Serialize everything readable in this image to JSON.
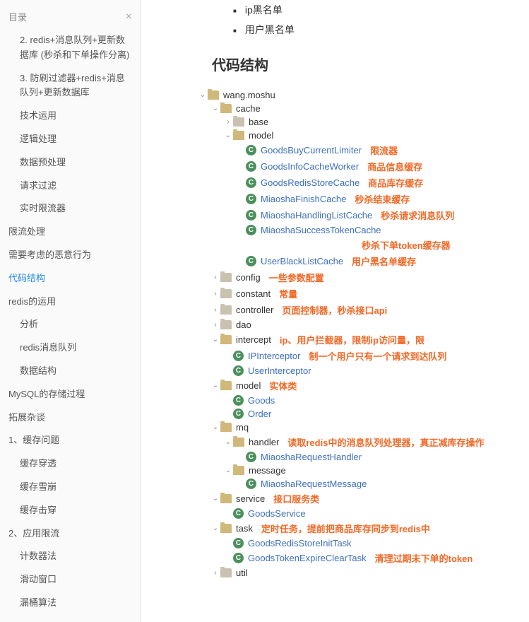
{
  "sidebar": {
    "title": "目录",
    "items": [
      {
        "label": "2. redis+消息队列+更新数据库 (秒杀和下单操作分离)",
        "level": 2
      },
      {
        "label": "3. 防刷过滤器+redis+消息队列+更新数据库",
        "level": 2
      },
      {
        "label": "技术运用",
        "level": 2
      },
      {
        "label": "逻辑处理",
        "level": 2
      },
      {
        "label": "数据预处理",
        "level": 2
      },
      {
        "label": "请求过滤",
        "level": 2
      },
      {
        "label": "实时限流器",
        "level": 2
      },
      {
        "label": "限流处理",
        "level": 1
      },
      {
        "label": "需要考虑的恶意行为",
        "level": 1
      },
      {
        "label": "代码结构",
        "level": 1,
        "active": true
      },
      {
        "label": "redis的运用",
        "level": 1
      },
      {
        "label": "分析",
        "level": 2
      },
      {
        "label": "redis消息队列",
        "level": 2
      },
      {
        "label": "数据结构",
        "level": 2
      },
      {
        "label": "MySQL的存储过程",
        "level": 1
      },
      {
        "label": "拓展杂谈",
        "level": 1
      },
      {
        "label": "1、缓存问题",
        "level": 1
      },
      {
        "label": "缓存穿透",
        "level": 2
      },
      {
        "label": "缓存雪崩",
        "level": 2
      },
      {
        "label": "缓存击穿",
        "level": 2
      },
      {
        "label": "2、应用限流",
        "level": 1
      },
      {
        "label": "计数器法",
        "level": 2
      },
      {
        "label": "滑动窗口",
        "level": 2
      },
      {
        "label": "漏桶算法",
        "level": 2
      }
    ]
  },
  "main": {
    "bullets": [
      "ip黑名单",
      "用户黑名单"
    ],
    "heading": "代码结构",
    "tree": [
      {
        "depth": 0,
        "arrow": "down",
        "icon": "folder",
        "label": "wang.moshu"
      },
      {
        "depth": 1,
        "arrow": "down",
        "icon": "folder",
        "label": "cache"
      },
      {
        "depth": 2,
        "arrow": "right",
        "icon": "folder-closed",
        "label": "base"
      },
      {
        "depth": 2,
        "arrow": "down",
        "icon": "folder",
        "label": "model"
      },
      {
        "depth": 3,
        "arrow": "",
        "icon": "class",
        "label": "GoodsBuyCurrentLimiter",
        "link": true,
        "ann": "限流器"
      },
      {
        "depth": 3,
        "arrow": "",
        "icon": "class",
        "label": "GoodsInfoCacheWorker",
        "link": true,
        "ann": "商品信息缓存"
      },
      {
        "depth": 3,
        "arrow": "",
        "icon": "class",
        "label": "GoodsRedisStoreCache",
        "link": true,
        "ann": "商品库存缓存"
      },
      {
        "depth": 3,
        "arrow": "",
        "icon": "class",
        "label": "MiaoshaFinishCache",
        "link": true,
        "ann": "秒杀结束缓存"
      },
      {
        "depth": 3,
        "arrow": "",
        "icon": "class",
        "label": "MiaoshaHandlingListCache",
        "link": true,
        "ann": "秒杀请求消息队列"
      },
      {
        "depth": 3,
        "arrow": "",
        "icon": "class",
        "label": "MiaoshaSuccessTokenCache",
        "link": true,
        "ann": "秒杀下单token缓存器",
        "annBelow": true
      },
      {
        "depth": 3,
        "arrow": "",
        "icon": "class",
        "label": "UserBlackListCache",
        "link": true,
        "ann": "用户黑名单缓存"
      },
      {
        "depth": 1,
        "arrow": "right",
        "icon": "folder-closed",
        "label": "config",
        "ann": "一些参数配置"
      },
      {
        "depth": 1,
        "arrow": "right",
        "icon": "folder-closed",
        "label": "constant",
        "ann": "常量"
      },
      {
        "depth": 1,
        "arrow": "right",
        "icon": "folder-closed",
        "label": "controller",
        "ann": "页面控制器，秒杀接口api"
      },
      {
        "depth": 1,
        "arrow": "right",
        "icon": "folder-closed",
        "label": "dao"
      },
      {
        "depth": 1,
        "arrow": "down",
        "icon": "folder",
        "label": "intercept",
        "ann": "ip、用户拦截器，限制ip访问量，限"
      },
      {
        "depth": 2,
        "arrow": "",
        "icon": "class",
        "label": "IPInterceptor",
        "link": true,
        "ann": "制一个用户只有一个请求到达队列"
      },
      {
        "depth": 2,
        "arrow": "",
        "icon": "class",
        "label": "UserInterceptor",
        "link": true
      },
      {
        "depth": 1,
        "arrow": "down",
        "icon": "folder",
        "label": "model",
        "ann": "实体类"
      },
      {
        "depth": 2,
        "arrow": "",
        "icon": "class",
        "label": "Goods",
        "link": true
      },
      {
        "depth": 2,
        "arrow": "",
        "icon": "class",
        "label": "Order",
        "link": true
      },
      {
        "depth": 1,
        "arrow": "down",
        "icon": "folder",
        "label": "mq"
      },
      {
        "depth": 2,
        "arrow": "down",
        "icon": "folder",
        "label": "handler",
        "ann": "读取redis中的消息队列处理器，真正减库存操作"
      },
      {
        "depth": 3,
        "arrow": "",
        "icon": "class",
        "label": "MiaoshaRequestHandler",
        "link": true
      },
      {
        "depth": 2,
        "arrow": "down",
        "icon": "folder",
        "label": "message"
      },
      {
        "depth": 3,
        "arrow": "",
        "icon": "class",
        "label": "MiaoshaRequestMessage",
        "link": true
      },
      {
        "depth": 1,
        "arrow": "down",
        "icon": "folder",
        "label": "service",
        "ann": "接口服务类"
      },
      {
        "depth": 2,
        "arrow": "",
        "icon": "class",
        "label": "GoodsService",
        "link": true
      },
      {
        "depth": 1,
        "arrow": "down",
        "icon": "folder",
        "label": "task",
        "ann": "定时任务，提前把商品库存同步到redis中"
      },
      {
        "depth": 2,
        "arrow": "",
        "icon": "class",
        "label": "GoodsRedisStoreInitTask",
        "link": true
      },
      {
        "depth": 2,
        "arrow": "",
        "icon": "class",
        "label": "GoodsTokenExpireClearTask",
        "link": true,
        "ann": "清理过期未下单的token"
      },
      {
        "depth": 1,
        "arrow": "right",
        "icon": "folder-closed",
        "label": "util"
      }
    ]
  }
}
